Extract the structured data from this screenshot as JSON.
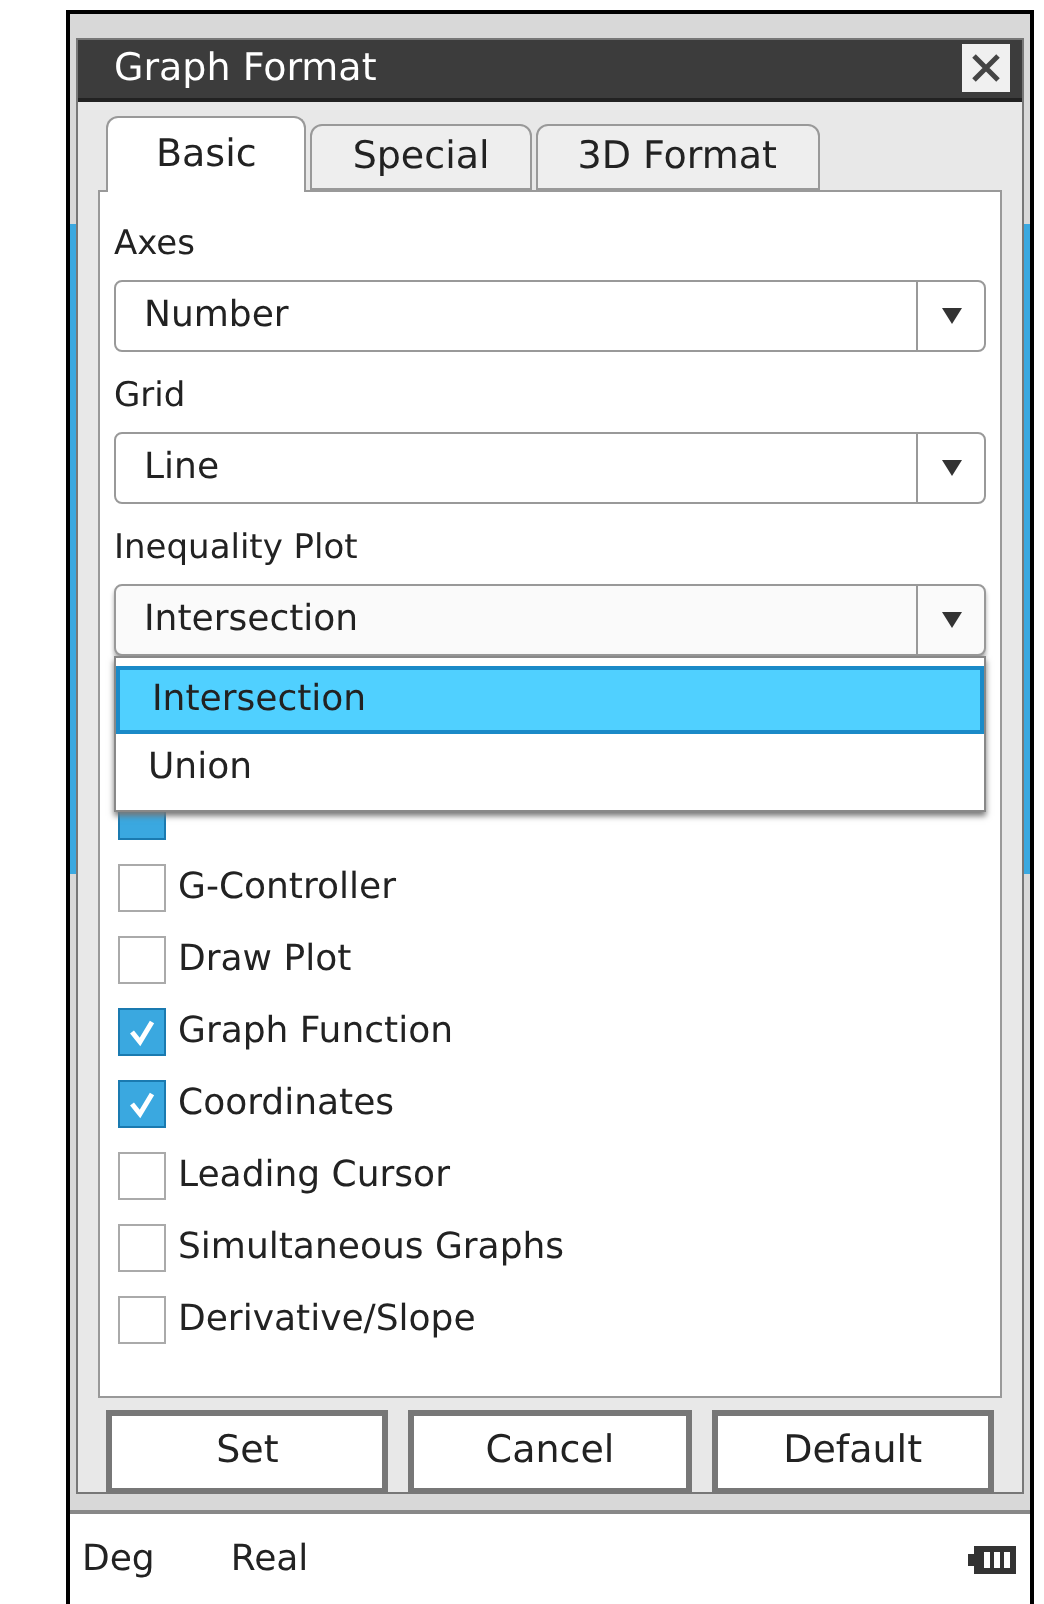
{
  "window": {
    "title": "Graph Format"
  },
  "tabs": [
    {
      "label": "Basic",
      "selected": true
    },
    {
      "label": "Special",
      "selected": false
    },
    {
      "label": "3D Format",
      "selected": false
    }
  ],
  "settings": [
    {
      "label": "Axes",
      "value": "Number",
      "expanded": false
    },
    {
      "label": "Grid",
      "value": "Line",
      "expanded": false
    },
    {
      "label": "Inequality Plot",
      "value": "Intersection",
      "expanded": true,
      "options": [
        {
          "label": "Intersection",
          "selected": true
        },
        {
          "label": "Union",
          "selected": false
        }
      ]
    }
  ],
  "checkboxes": [
    {
      "checked": true
    },
    {
      "label": "G-Controller",
      "checked": false
    },
    {
      "label": "Draw Plot",
      "checked": false
    },
    {
      "label": "Graph Function",
      "checked": true
    },
    {
      "label": "Coordinates",
      "checked": true
    },
    {
      "label": "Leading Cursor",
      "checked": false
    },
    {
      "label": "Simultaneous Graphs",
      "checked": false
    },
    {
      "label": "Derivative/Slope",
      "checked": false
    }
  ],
  "buttons": [
    "Set",
    "Cancel",
    "Default"
  ],
  "status_bar": {
    "angle": "Deg",
    "mode": "Real"
  }
}
